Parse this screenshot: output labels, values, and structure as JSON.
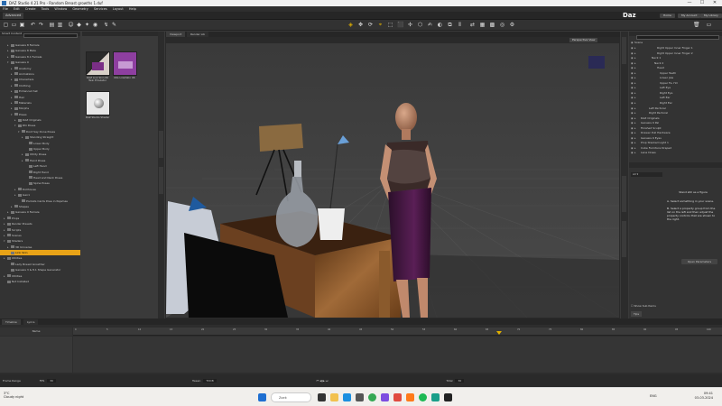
{
  "window": {
    "title": "DAZ Studio 4.21 Pro - Random Breast growths 1.duf",
    "min": "—",
    "max": "☐",
    "close": "✕"
  },
  "menu": [
    "File",
    "Edit",
    "Create",
    "Tools",
    "Window",
    "Geometry",
    "Services",
    "Layout",
    "Help"
  ],
  "layout_label": "Advanced",
  "brand": "Daz",
  "top_buttons": [
    "Home",
    "My Account",
    "My Library",
    "Shop"
  ],
  "left_panel": {
    "tab": "Smart Content",
    "tree": [
      {
        "label": "Genesis 8 Female",
        "indent": 2,
        "arrow": "▸"
      },
      {
        "label": "Genesis 8 Male",
        "indent": 2,
        "arrow": "▸"
      },
      {
        "label": "Genesis 8.1 Female",
        "indent": 2,
        "arrow": "▸"
      },
      {
        "label": "Genesis 9",
        "indent": 2,
        "arrow": "▾"
      },
      {
        "label": "Anatomy",
        "indent": 3,
        "arrow": "▸"
      },
      {
        "label": "Animations",
        "indent": 3,
        "arrow": "▸"
      },
      {
        "label": "Characters",
        "indent": 3,
        "arrow": "▸"
      },
      {
        "label": "Clothing",
        "indent": 3,
        "arrow": "▸"
      },
      {
        "label": "Enhanced Set",
        "indent": 3,
        "arrow": "▸"
      },
      {
        "label": "Hair",
        "indent": 3,
        "arrow": "▸"
      },
      {
        "label": "Materials",
        "indent": 3,
        "arrow": "▸"
      },
      {
        "label": "Morphs",
        "indent": 3,
        "arrow": "▸"
      },
      {
        "label": "Poses",
        "indent": 3,
        "arrow": "▾"
      },
      {
        "label": "DAZ Originals",
        "indent": 4,
        "arrow": "▸"
      },
      {
        "label": "Rhi Poses",
        "indent": 4,
        "arrow": "▾"
      },
      {
        "label": "Dont Say Done Poses",
        "indent": 5,
        "arrow": "▾"
      },
      {
        "label": "Standing Straight",
        "indent": 6,
        "arrow": "▸"
      },
      {
        "label": "Lower Body",
        "indent": 7,
        "arrow": ""
      },
      {
        "label": "Upper Body",
        "indent": 7,
        "arrow": ""
      },
      {
        "label": "Utility Poses",
        "indent": 6,
        "arrow": "▸"
      },
      {
        "label": "Hand Poses",
        "indent": 6,
        "arrow": "▸"
      },
      {
        "label": "Left Hand",
        "indent": 7,
        "arrow": ""
      },
      {
        "label": "Right Hand",
        "indent": 7,
        "arrow": ""
      },
      {
        "label": "Head and Neck Poses",
        "indent": 7,
        "arrow": ""
      },
      {
        "label": "Spine Poses",
        "indent": 7,
        "arrow": ""
      },
      {
        "label": "Dollhouse",
        "indent": 4,
        "arrow": "▸"
      },
      {
        "label": "Gen1",
        "indent": 4,
        "arrow": "▸"
      },
      {
        "label": "Pockets Cards Pose in Pajamas",
        "indent": 5,
        "arrow": ""
      },
      {
        "label": "Shapes",
        "indent": 3,
        "arrow": "▸"
      },
      {
        "label": "Genesis 9 Female",
        "indent": 2,
        "arrow": "▸"
      },
      {
        "label": "Props",
        "indent": 1,
        "arrow": "▸"
      },
      {
        "label": "Render Presets",
        "indent": 1,
        "arrow": "▸"
      },
      {
        "label": "Scripts",
        "indent": 1,
        "arrow": "▸"
      },
      {
        "label": "Scenes",
        "indent": 1,
        "arrow": "▸"
      },
      {
        "label": "Shaders",
        "indent": 1,
        "arrow": "▾"
      },
      {
        "label": "3D Universe",
        "indent": 2,
        "arrow": "▸"
      },
      {
        "label": "Link Skin",
        "indent": 2,
        "arrow": "",
        "selected": true
      },
      {
        "label": "Utilities",
        "indent": 1,
        "arrow": "▸"
      },
      {
        "label": "Lady Breast Growther",
        "indent": 2,
        "arrow": ""
      },
      {
        "label": "Genesis 3 & 8.1 Shape Generator",
        "indent": 2,
        "arrow": ""
      },
      {
        "label": "Utilities",
        "indent": 1,
        "arrow": "▸"
      },
      {
        "label": "Not Installed",
        "indent": 1,
        "arrow": ""
      }
    ]
  },
  "content_items": [
    {
      "caption": "DAZ Link Skin 06 Twin Emulator"
    },
    {
      "caption": "IDG Link/Skin 06"
    },
    {
      "caption": "DAZ Studio Shader"
    }
  ],
  "viewport": {
    "tabs": [
      "Viewport",
      "Render Lib"
    ],
    "view_label": "Perspective View"
  },
  "scene": {
    "header": "Scene",
    "items": [
      {
        "label": "Right Upper Inner Finger 1",
        "indent": 7
      },
      {
        "label": "Right Upper Inner Finger 2",
        "indent": 7
      },
      {
        "label": "Neck 1",
        "indent": 5
      },
      {
        "label": "Neck 2",
        "indent": 6
      },
      {
        "label": "Head",
        "indent": 7
      },
      {
        "label": "Upper Teeth",
        "indent": 8
      },
      {
        "label": "Lower Jaw",
        "indent": 8
      },
      {
        "label": "Upper Fe. Hd",
        "indent": 8
      },
      {
        "label": "Left Eye",
        "indent": 8
      },
      {
        "label": "Right Eye",
        "indent": 8
      },
      {
        "label": "Left Ear",
        "indent": 8
      },
      {
        "label": "Right Ear",
        "indent": 8
      },
      {
        "label": "Left Pectoral",
        "indent": 4
      },
      {
        "label": "Right Pectoral",
        "indent": 4
      },
      {
        "label": "DAZ Originals",
        "indent": 1
      },
      {
        "label": "Genesis 9 Pal",
        "indent": 1
      },
      {
        "label": "Finished Sculpt",
        "indent": 1
      },
      {
        "label": "Drawer Pull Hardware",
        "indent": 1
      },
      {
        "label": "Genesis 9 Eyes",
        "indent": 1
      },
      {
        "label": "Prop Stacked Light 1",
        "indent": 1
      },
      {
        "label": "Cube Furniture Draped",
        "indent": 1
      },
      {
        "label": "Lane Dress",
        "indent": 1
      }
    ]
  },
  "properties": {
    "filter": "Show Sub Items",
    "help_title": "Tips & Help",
    "help_lines": [
      "Stand still as a figure",
      "A. Select something in your scene.",
      "B. Select a property group from the list on the left and then adjust the property controls that are shown to the right."
    ],
    "btn": "Open Parameters"
  },
  "timeline": {
    "tabs": [
      "Timeline",
      "Lyrics"
    ],
    "name_col": "Name",
    "ticks": [
      "0",
      "5",
      "10",
      "15",
      "20",
      "25",
      "30",
      "35",
      "40",
      "45",
      "50",
      "55",
      "60",
      "65",
      "70",
      "75",
      "80",
      "85",
      "90",
      "95",
      "100"
    ],
    "range_label": "Frame Range",
    "fps_label": "FPS",
    "fps": "30",
    "tween_label": "Tween",
    "tween": "TDCB",
    "total_label": "Total",
    "total": "30",
    "current": "0"
  },
  "taskbar": {
    "weather_temp": "3°C",
    "weather_desc": "Cloudy night",
    "search": "Zoek",
    "lang": "ENG",
    "time": "09:41",
    "date": "03-03-2024"
  }
}
